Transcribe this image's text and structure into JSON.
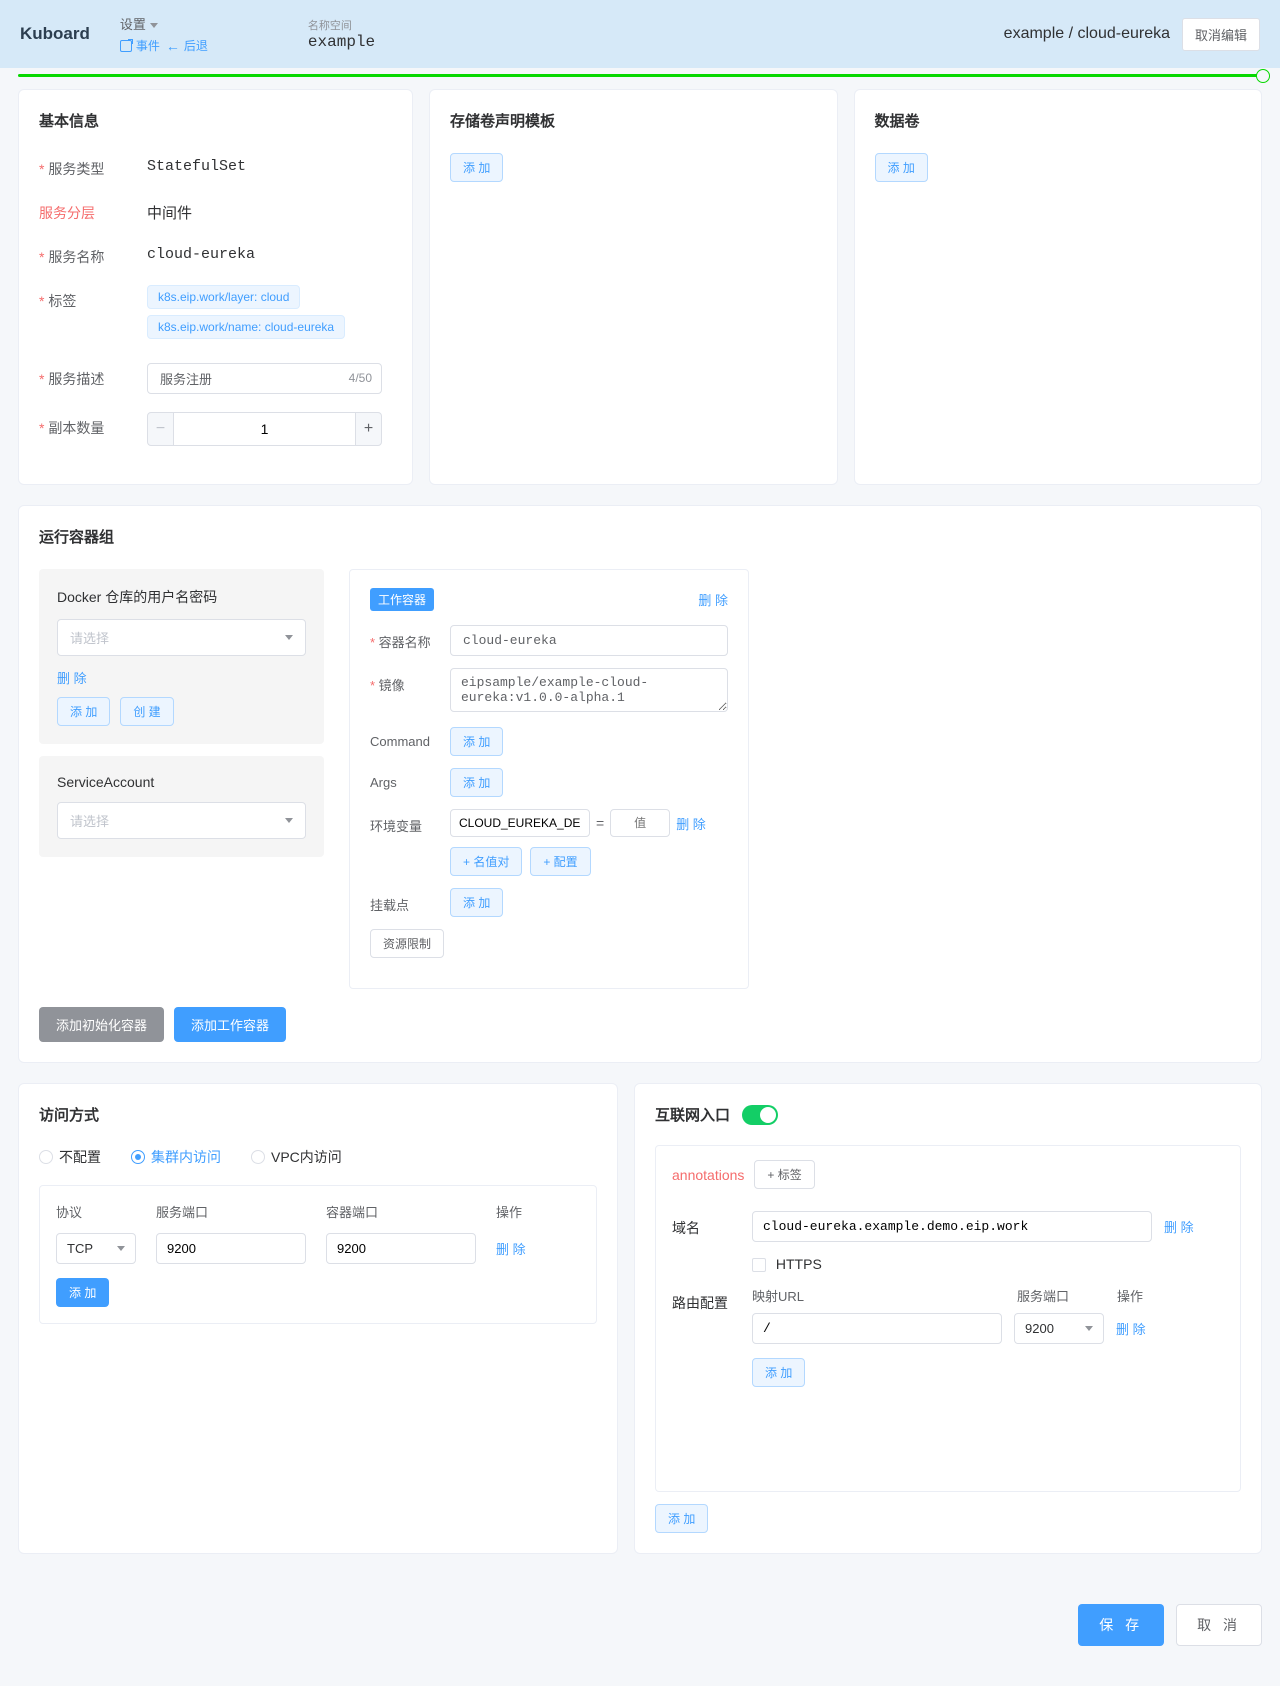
{
  "header": {
    "logo": "Kuboard",
    "settings": "设置",
    "events": "事件",
    "back": "后退",
    "namespace_label": "名称空间",
    "namespace_value": "example",
    "breadcrumb": "example / cloud-eureka",
    "cancel_edit": "取消编辑"
  },
  "basic": {
    "title": "基本信息",
    "service_type_label": "服务类型",
    "service_type": "StatefulSet",
    "layer_label": "服务分层",
    "layer": "中间件",
    "name_label": "服务名称",
    "name": "cloud-eureka",
    "labels_label": "标签",
    "labels": [
      "k8s.eip.work/layer: cloud",
      "k8s.eip.work/name: cloud-eureka"
    ],
    "desc_label": "服务描述",
    "desc_value": "服务注册",
    "desc_count": "4/50",
    "replicas_label": "副本数量",
    "replicas": "1"
  },
  "storage": {
    "title": "存储卷声明模板",
    "add": "添 加"
  },
  "volume": {
    "title": "数据卷",
    "add": "添 加"
  },
  "containers": {
    "title": "运行容器组",
    "docker": {
      "title": "Docker 仓库的用户名密码",
      "select_placeholder": "请选择",
      "delete": "删 除",
      "add": "添 加",
      "create": "创 建"
    },
    "sa": {
      "title": "ServiceAccount",
      "select_placeholder": "请选择"
    },
    "detail": {
      "badge": "工作容器",
      "delete": "删 除",
      "name_label": "容器名称",
      "name": "cloud-eureka",
      "image_label": "镜像",
      "image": "eipsample/example-cloud-eureka:v1.0.0-alpha.1",
      "command_label": "Command",
      "args_label": "Args",
      "env_label": "环境变量",
      "env_key": "CLOUD_EUREKA_DE",
      "env_val_placeholder": "值",
      "env_delete": "删 除",
      "add_kv": "+ 名值对",
      "add_cfg": "+ 配置",
      "mount_label": "挂载点",
      "add": "添 加",
      "resource_limit": "资源限制"
    },
    "add_init": "添加初始化容器",
    "add_work": "添加工作容器"
  },
  "access": {
    "title": "访问方式",
    "radios": [
      "不配置",
      "集群内访问",
      "VPC内访问"
    ],
    "headers": [
      "协议",
      "服务端口",
      "容器端口",
      "操作"
    ],
    "protocol": "TCP",
    "svc_port": "9200",
    "container_port": "9200",
    "delete": "删 除",
    "add": "添 加"
  },
  "ingress": {
    "title": "互联网入口",
    "annotations": "annotations",
    "add_tag": "+ 标签",
    "domain_label": "域名",
    "domain": "cloud-eureka.example.demo.eip.work",
    "delete": "删 除",
    "https": "HTTPS",
    "route_label": "路由配置",
    "route_headers": [
      "映射URL",
      "服务端口",
      "操作"
    ],
    "route_url": "/",
    "route_port": "9200",
    "add": "添 加"
  },
  "footer": {
    "save": "保 存",
    "cancel": "取 消"
  }
}
